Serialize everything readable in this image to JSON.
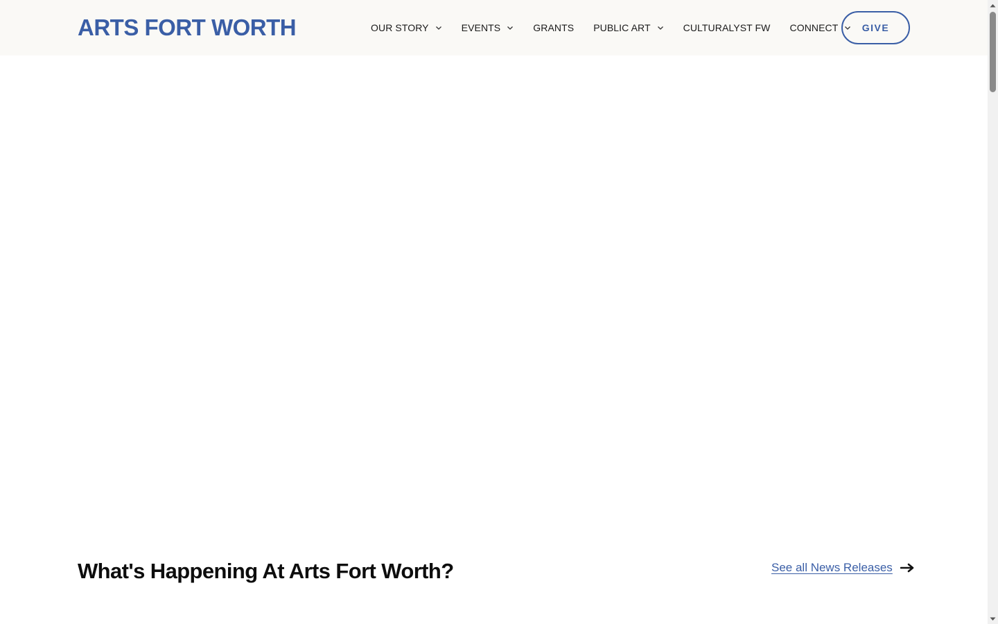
{
  "header": {
    "logo": "ARTS FORT WORTH",
    "nav": [
      {
        "label": "OUR STORY",
        "dropdown": true
      },
      {
        "label": "EVENTS",
        "dropdown": true
      },
      {
        "label": "GRANTS",
        "dropdown": false
      },
      {
        "label": "PUBLIC ART",
        "dropdown": true
      },
      {
        "label": "CULTURALYST FW",
        "dropdown": false
      },
      {
        "label": "CONNECT",
        "dropdown": true
      }
    ],
    "give_label": "GIVE"
  },
  "news": {
    "title": "What's Happening At Arts Fort Worth?",
    "link_label": "See all News Releases"
  },
  "colors": {
    "brand": "#3a5ea6",
    "header_bg": "#faf9f6",
    "text": "#1a1a1a"
  },
  "scroll": {
    "position_fraction": 0.0
  }
}
